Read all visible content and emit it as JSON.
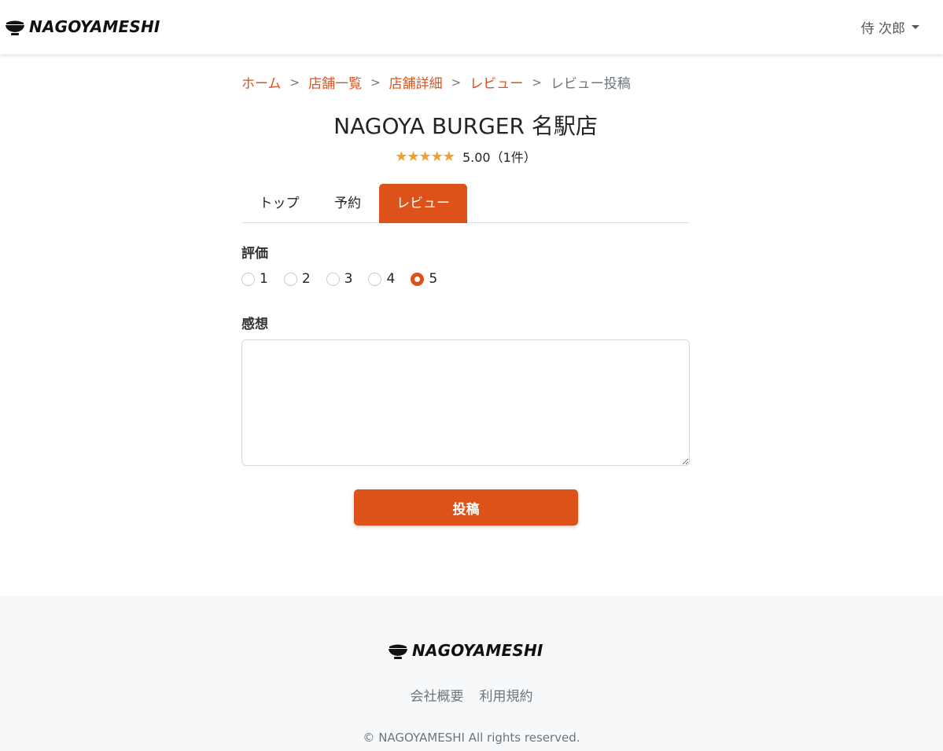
{
  "header": {
    "brand": "NAGOYAMESHI",
    "user_name": "侍 次郎"
  },
  "breadcrumb": {
    "items": [
      "ホーム",
      "店舗一覧",
      "店舗詳細",
      "レビュー"
    ],
    "current": "レビュー投稿",
    "separator": ">"
  },
  "store": {
    "name": "NAGOYA BURGER 名駅店",
    "stars": "★★★★★",
    "rating": 5.0,
    "rating_text": "5.00（1件）"
  },
  "tabs": [
    "トップ",
    "予約",
    "レビュー"
  ],
  "active_tab": "レビュー",
  "form": {
    "rating_label": "評価",
    "rating_options": [
      "1",
      "2",
      "3",
      "4",
      "5"
    ],
    "rating_selected": "5",
    "comment_label": "感想",
    "comment_value": "",
    "submit_label": "投稿"
  },
  "footer": {
    "brand": "NAGOYAMESHI",
    "links": [
      "会社概要",
      "利用規約"
    ],
    "copyright": "© NAGOYAMESHI All rights reserved."
  },
  "colors": {
    "accent": "#dc5219",
    "star": "#f0a12b",
    "footer_bg": "#f7f8fa"
  },
  "icons": {
    "logo": "rice-bowl-icon",
    "user_menu": "caret-down-icon"
  }
}
